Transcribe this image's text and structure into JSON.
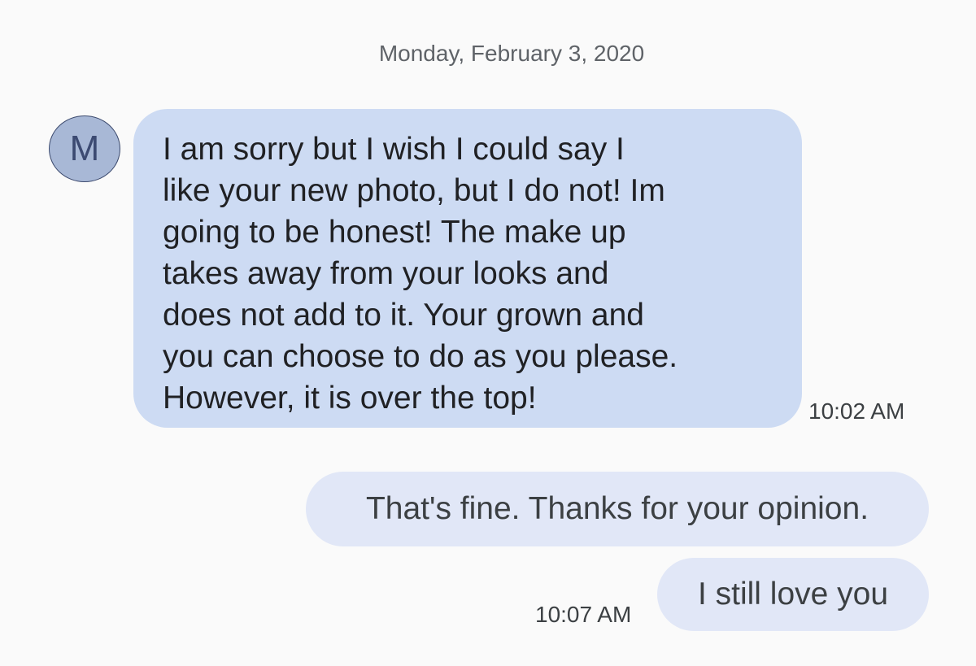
{
  "conversation": {
    "date_header": "Monday, February 3, 2020",
    "contact": {
      "avatar_initial": "M",
      "avatar_color": "#a8b8d6"
    },
    "messages": [
      {
        "direction": "incoming",
        "text": "I am sorry but I wish I could say I\nlike your new photo, but I do not!   Im\ngoing to be honest!  The make up\ntakes away from your looks and\ndoes not add to it.   Your grown and\nyou can choose to do as you please.\nHowever,  it is over the top!",
        "time": "10:02 AM",
        "bubble_color": "#cddbf3"
      },
      {
        "direction": "outgoing",
        "text": "That's fine. Thanks for your opinion.",
        "bubble_color": "#e1e7f7"
      },
      {
        "direction": "outgoing",
        "text": "I still love you",
        "time": "10:07 AM",
        "bubble_color": "#e1e7f7"
      }
    ]
  }
}
